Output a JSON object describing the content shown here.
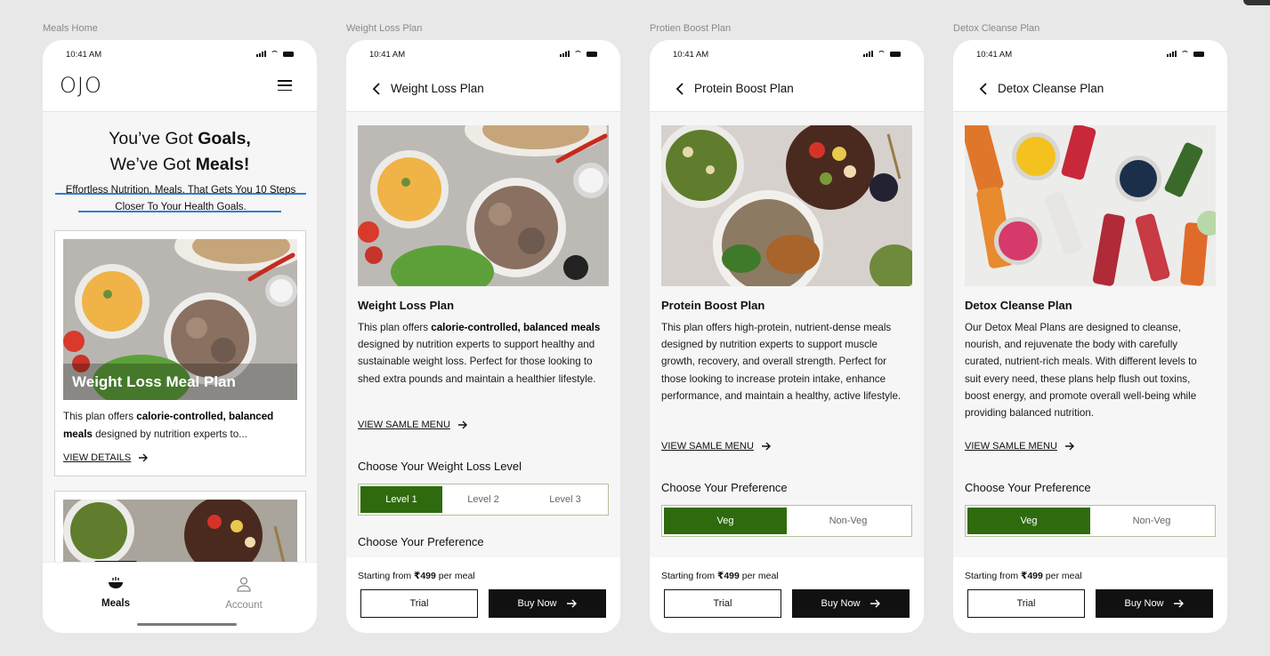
{
  "frames": [
    {
      "label": "Meals Home"
    },
    {
      "label": "Weight Loss Plan"
    },
    {
      "label": "Protien Boost Plan"
    },
    {
      "label": "Detox Cleanse Plan"
    }
  ],
  "status": {
    "time": "10:41 AM"
  },
  "home": {
    "logo": "OJO",
    "hero_line1_pre": "You’ve Got ",
    "hero_line1_bold": "Goals,",
    "hero_line2_pre": "We’ve Got ",
    "hero_line2_bold": "Meals!",
    "subtitle": "Effortless Nutrition. Meals. That Gets You 10 Steps Closer To Your Health Goals.",
    "card1": {
      "overlay": "Weight Loss Meal Plan",
      "desc_pre": "This plan offers ",
      "desc_bold": "calorie-controlled, balanced meals",
      "desc_post": " designed by nutrition experts to...",
      "link": "VIEW DETAILS"
    },
    "tabs": [
      {
        "label": "Meals",
        "icon": "bowl-icon"
      },
      {
        "label": "Account",
        "icon": "user-icon"
      }
    ]
  },
  "weight_loss": {
    "title": "Weight Loss Plan",
    "heading": "Weight Loss Plan",
    "desc_pre": "This plan offers ",
    "desc_bold": "calorie-controlled, balanced meals",
    "desc_post": " designed by nutrition experts to support healthy and sustainable weight loss. Perfect for those looking to shed extra pounds and maintain a healthier lifestyle.",
    "menu_link": "VIEW SAMLE MENU",
    "level_heading": "Choose Your Weight Loss Level",
    "levels": [
      "Level 1",
      "Level 2",
      "Level 3"
    ],
    "selected_level": "Level 1",
    "pref_heading": "Choose Your Preference"
  },
  "protein": {
    "title": "Protein Boost Plan",
    "heading": "Protein Boost Plan",
    "desc": "This plan offers high-protein, nutrient-dense meals designed by nutrition experts to support muscle growth, recovery, and overall strength. Perfect for those looking to increase protein intake, enhance performance, and maintain a healthy, active lifestyle.",
    "menu_link": "VIEW SAMLE MENU",
    "pref_heading": "Choose Your Preference",
    "options": [
      "Veg",
      "Non-Veg"
    ],
    "selected": "Veg"
  },
  "detox": {
    "title": "Detox Cleanse Plan",
    "heading": "Detox Cleanse Plan",
    "desc": "Our Detox Meal Plans are designed to cleanse, nourish, and rejuvenate the body with carefully curated, nutrient-rich meals. With different levels to suit every need, these plans help flush out toxins, boost energy, and promote overall well-being while providing balanced nutrition.",
    "menu_link": "VIEW SAMLE MENU",
    "pref_heading": "Choose Your Preference",
    "options": [
      "Veg",
      "Non-Veg"
    ],
    "selected": "Veg"
  },
  "purchase": {
    "price_pre": "Starting from ",
    "price_bold": "₹499",
    "price_post": " per meal",
    "trial_label": "Trial",
    "buy_label": "Buy Now"
  },
  "colors": {
    "accent": "#2f6a0e",
    "underline": "#2f7fd0",
    "dark": "#111111"
  }
}
